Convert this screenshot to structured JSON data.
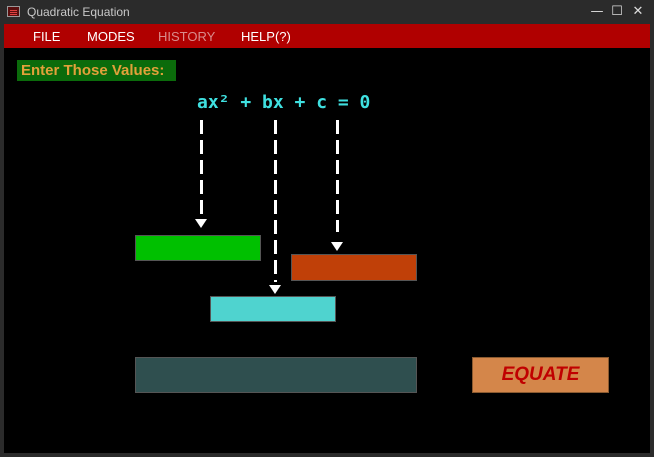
{
  "window": {
    "title": "Quadratic Equation",
    "controls": {
      "minimize": "—",
      "maximize": "☐",
      "close": "✕"
    }
  },
  "menu": {
    "items": [
      {
        "label": "FILE",
        "disabled": false
      },
      {
        "label": "MODES",
        "disabled": false
      },
      {
        "label": "HISTORY",
        "disabled": true
      },
      {
        "label": "HELP(?)",
        "disabled": false
      }
    ]
  },
  "main": {
    "prompt": "Enter Those Values:",
    "equation": "ax² + bx + c = 0",
    "inputs": {
      "a": {
        "value": "",
        "color": "#00c000"
      },
      "b": {
        "value": "",
        "color": "#4fd3cf"
      },
      "c": {
        "value": "",
        "color": "#c04008"
      }
    },
    "result": {
      "value": "",
      "color": "#2f4f4f"
    },
    "equate_label": "EQUATE"
  },
  "colors": {
    "menubar": "#b00000",
    "equation_text": "#3fe0e0",
    "prompt_bg": "#0b6b0b",
    "prompt_text": "#e2a13a",
    "equate_bg": "#d4864a",
    "equate_text": "#c00000"
  }
}
